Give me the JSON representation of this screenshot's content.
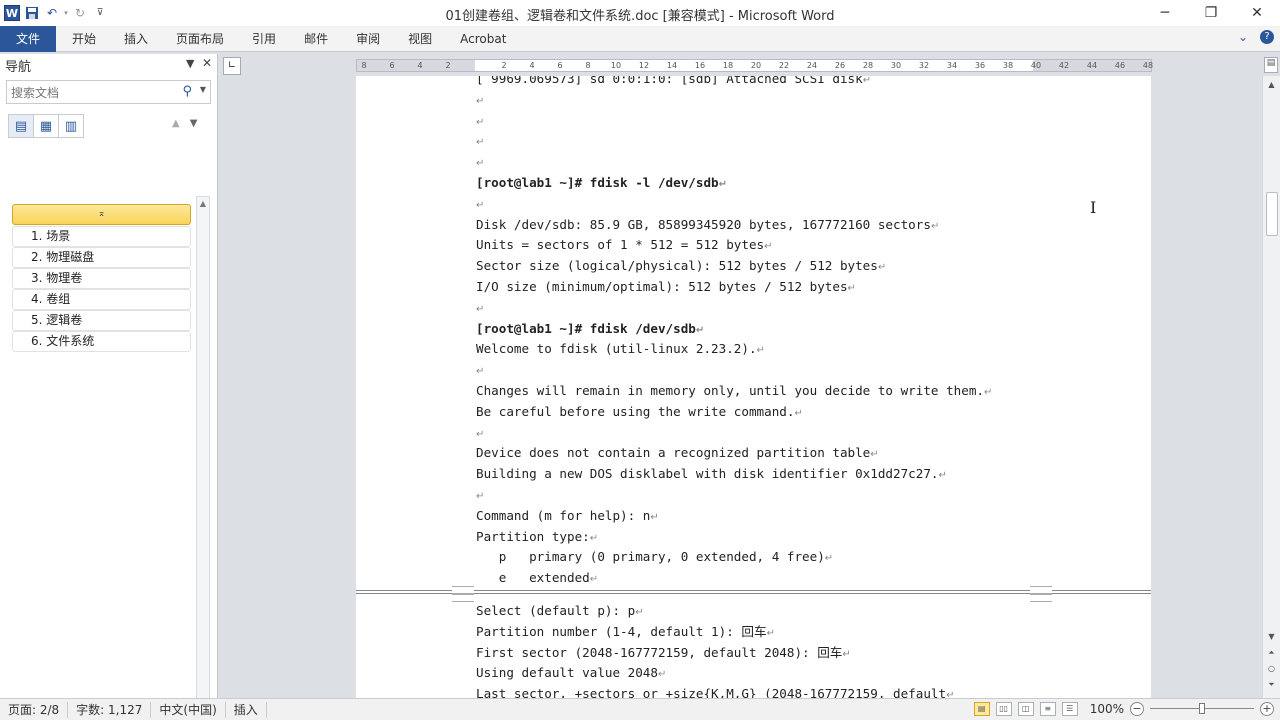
{
  "window": {
    "title": "01创建卷组、逻辑卷和文件系统.doc [兼容模式] - Microsoft Word",
    "app_icon": "W",
    "controls": {
      "minimize": "─",
      "restore": "❐",
      "close": "✕"
    }
  },
  "ribbon": {
    "file_tab": "文件",
    "tabs": [
      "开始",
      "插入",
      "页面布局",
      "引用",
      "邮件",
      "审阅",
      "视图",
      "Acrobat"
    ]
  },
  "nav": {
    "title": "导航",
    "search_placeholder": "搜索文档",
    "top_item": "⌅",
    "items": [
      "1. 场景",
      "2. 物理磁盘",
      "3. 物理卷",
      "4. 卷组",
      "5. 逻辑卷",
      "6. 文件系统"
    ]
  },
  "ruler": {
    "ticks": [
      "8",
      "6",
      "4",
      "2",
      "2",
      "4",
      "6",
      "8",
      "10",
      "12",
      "14",
      "16",
      "18",
      "20",
      "22",
      "24",
      "26",
      "28",
      "30",
      "32",
      "34",
      "36",
      "38",
      "40",
      "42",
      "44",
      "46",
      "48"
    ]
  },
  "document": {
    "page1_lines": [
      {
        "text": "[ 9969.069573] sd 0:0:1:0: [sdb] Attached SCSI disk",
        "bold": false
      },
      {
        "text": "",
        "bold": false
      },
      {
        "text": "",
        "bold": false
      },
      {
        "text": "",
        "bold": false
      },
      {
        "text": "",
        "bold": false
      },
      {
        "text": "[root@lab1 ~]# fdisk -l /dev/sdb",
        "bold": true
      },
      {
        "text": "",
        "bold": false
      },
      {
        "text": "Disk /dev/sdb: 85.9 GB, 85899345920 bytes, 167772160 sectors",
        "bold": false
      },
      {
        "text": "Units = sectors of 1 * 512 = 512 bytes",
        "bold": false
      },
      {
        "text": "Sector size (logical/physical): 512 bytes / 512 bytes",
        "bold": false
      },
      {
        "text": "I/O size (minimum/optimal): 512 bytes / 512 bytes",
        "bold": false
      },
      {
        "text": "",
        "bold": false
      },
      {
        "text": "[root@lab1 ~]# fdisk /dev/sdb",
        "bold": true
      },
      {
        "text": "Welcome to fdisk (util-linux 2.23.2).",
        "bold": false
      },
      {
        "text": "",
        "bold": false
      },
      {
        "text": "Changes will remain in memory only, until you decide to write them.",
        "bold": false
      },
      {
        "text": "Be careful before using the write command.",
        "bold": false
      },
      {
        "text": "",
        "bold": false
      },
      {
        "text": "Device does not contain a recognized partition table",
        "bold": false
      },
      {
        "text": "Building a new DOS disklabel with disk identifier 0x1dd27c27.",
        "bold": false
      },
      {
        "text": "",
        "bold": false
      },
      {
        "text": "Command (m for help): n",
        "bold": false
      },
      {
        "text": "Partition type:",
        "bold": false
      },
      {
        "text": "   p   primary (0 primary, 0 extended, 4 free)",
        "bold": false
      },
      {
        "text": "   e   extended",
        "bold": false
      }
    ],
    "page2_lines": [
      {
        "text": "Select (default p): p",
        "bold": false
      },
      {
        "text": "Partition number (1-4, default 1): 回车",
        "bold": false
      },
      {
        "text": "First sector (2048-167772159, default 2048): 回车",
        "bold": false
      },
      {
        "text": "Using default value 2048",
        "bold": false
      },
      {
        "text": "Last sector, +sectors or +size{K,M,G} (2048-167772159, default",
        "bold": false
      }
    ],
    "paragraph_mark": "↵"
  },
  "status": {
    "page": "页面: 2/8",
    "words": "字数: 1,127",
    "language": "中文(中国)",
    "mode": "插入",
    "zoom": "100%",
    "zoom_level": 0.5
  }
}
